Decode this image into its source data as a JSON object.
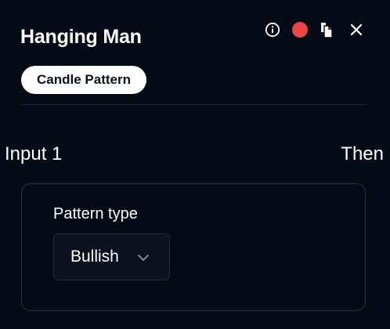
{
  "header": {
    "title": "Hanging Man",
    "badge": "Candle Pattern",
    "icons": {
      "info": "info-icon",
      "status": "status-dot-icon",
      "copy": "copy-icon",
      "close": "close-icon"
    }
  },
  "flow": {
    "input_label": "Input 1",
    "output_label": "Then"
  },
  "form": {
    "pattern_type_label": "Pattern type",
    "pattern_type_value": "Bullish"
  },
  "colors": {
    "background": "#050a17",
    "status_dot": "#ef4444",
    "badge_bg": "#ffffff",
    "text": "#ffffff"
  }
}
